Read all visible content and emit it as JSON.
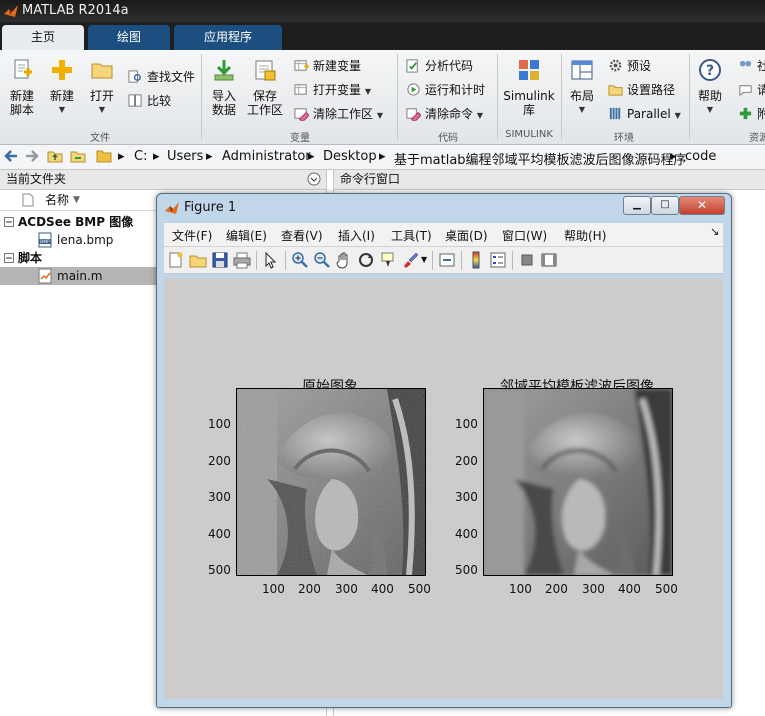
{
  "window": {
    "title": "MATLAB R2014a"
  },
  "ribbon_tabs": [
    {
      "label": "主页"
    },
    {
      "label": "绘图"
    },
    {
      "label": "应用程序"
    }
  ],
  "ribbon": {
    "new_script": "新建\n脚本",
    "new": "新建",
    "open": "打开",
    "find_files": "查找文件",
    "compare": "比较",
    "import_data": "导入\n数据",
    "save_workspace": "保存\n工作区",
    "new_variable": "新建变量",
    "open_variable": "打开变量",
    "clear_workspace": "清除工作区",
    "analyze_code": "分析代码",
    "run_and_time": "运行和计时",
    "clear_commands": "清除命令",
    "simulink": "Simulink\n库",
    "layout": "布局",
    "preferences": "预设",
    "set_path": "设置路径",
    "parallel": "Parallel",
    "help": "帮助",
    "group_file": "文件",
    "group_variable": "变量",
    "group_code": "代码",
    "group_simulink": "SIMULINK",
    "group_env": "环境",
    "group_resources": "资源",
    "cutoff_1": "社",
    "cutoff_2": "请",
    "cutoff_3": "附"
  },
  "address": {
    "crumbs": [
      "C:",
      "Users",
      "Administrator",
      "Desktop",
      "基于matlab编程邻域平均模板滤波后图像源码程序",
      "code"
    ]
  },
  "left_panel": {
    "title": "当前文件夹",
    "column_name": "名称",
    "groups": [
      {
        "label": "ACDSee BMP 图像",
        "files": [
          "lena.bmp"
        ]
      },
      {
        "label": "脚本",
        "files": [
          "main.m"
        ]
      }
    ]
  },
  "right_panel": {
    "title": "命令行窗口"
  },
  "figure": {
    "title": "Figure 1",
    "menu": [
      "文件(F)",
      "编辑(E)",
      "查看(V)",
      "插入(I)",
      "工具(T)",
      "桌面(D)",
      "窗口(W)",
      "帮助(H)"
    ],
    "plots": [
      {
        "title": "原始图象",
        "yticks": [
          "100",
          "200",
          "300",
          "400",
          "500"
        ],
        "xticks": [
          "100",
          "200",
          "300",
          "400",
          "500"
        ]
      },
      {
        "title": "邻域平均模板滤波后图像",
        "yticks": [
          "100",
          "200",
          "300",
          "400",
          "500"
        ],
        "xticks": [
          "100",
          "200",
          "300",
          "400",
          "500"
        ]
      }
    ]
  },
  "colors": {
    "titlebar": "#1a1a1a",
    "tab_active": "#e9ecef",
    "tab_inactive": "#1c4e80",
    "selection": "#b5b5b5",
    "figure_bg": "#cccccc",
    "figure_frame": "#c2d6ea"
  }
}
